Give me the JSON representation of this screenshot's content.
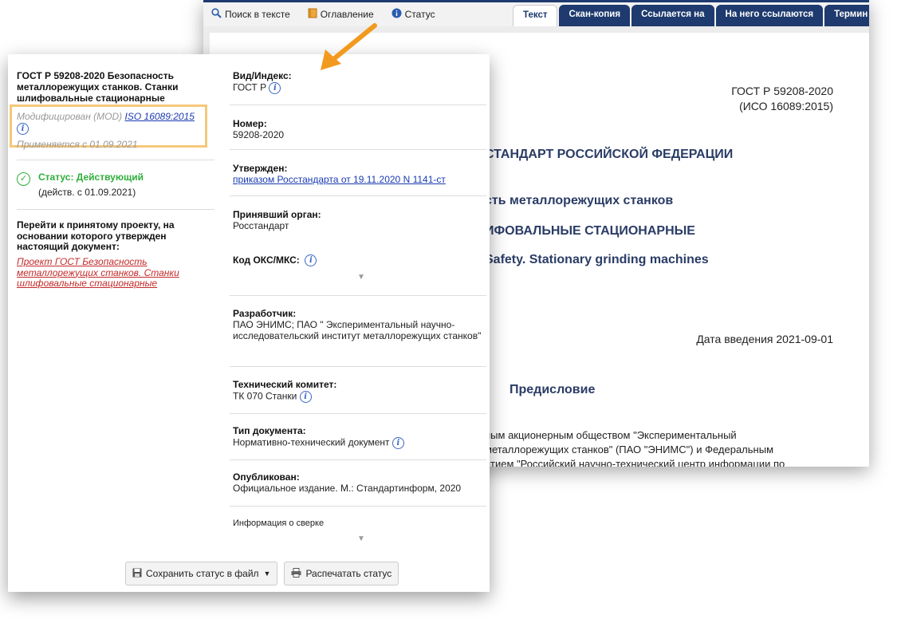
{
  "toolbar": {
    "search": "Поиск в тексте",
    "toc": "Оглавление",
    "status": "Статус"
  },
  "tabs": [
    "Текст",
    "Скан-копия",
    "Ссылается на",
    "На него ссылаются",
    "Термин"
  ],
  "doc": {
    "code": "ГОСТ Р 59208-2020",
    "iso": "(ИСО 16089:2015)",
    "h1": "СТАНДАРТ РОССИЙСКОЙ ФЕДЕРАЦИИ",
    "h2": "сть металлорежущих станков",
    "h3": "ИФОВАЛЬНЫЕ СТАЦИОНАРНЫЕ",
    "h4": "Safety. Stationary grinding machines",
    "date": "Дата введения 2021-09-01",
    "preface": "Предисловие",
    "p1": "ным     акционерным     обществом     \"Экспериментальный",
    "p2": "металлорежущих станков\" (ПАО \"ЭНИМС\") и Федеральным",
    "p3": "ятием \"Российский научно-технический центр информации по"
  },
  "left": {
    "title": "ГОСТ Р 59208-2020 Безопасность металлорежущих станков. Станки шлифовальные стационарные",
    "modified": "Модифицирован (MOD)",
    "iso_link": "ISO 16089:2015",
    "applies": "Применяется с 01.09.2021",
    "status_label": "Статус: Действующий",
    "status_date": "(действ. с 01.09.2021)",
    "goto": "Перейти к принятому проекту, на основании которого утвержден настоящий документ:",
    "goto_link": "Проект ГОСТ Безопасность металлорежущих станков. Станки шлифовальные стационарные"
  },
  "fields": {
    "kind_label": "Вид/Индекс:",
    "kind_value": "ГОСТ Р",
    "number_label": "Номер:",
    "number_value": "59208-2020",
    "approved_label": "Утвержден:",
    "approved_value": "приказом Росстандарта от 19.11.2020 N 1141-ст",
    "org_label": "Принявший орган:",
    "org_value": "Росстандарт",
    "oks_label": "Код ОКС/МКС:",
    "dev_label": "Разработчик:",
    "dev_value": "ПАО ЭНИМС; ПАО \" Экспериментальный научно-исследовательский институт металлорежущих станков\"",
    "tc_label": "Технический комитет:",
    "tc_value": "ТК 070 Станки",
    "type_label": "Тип документа:",
    "type_value": "Нормативно-технический документ",
    "pub_label": "Опубликован:",
    "pub_value": "Официальное издание. М.: Стандартинформ, 2020",
    "recon_label": "Информация о сверке"
  },
  "buttons": {
    "save": "Сохранить статус в файл",
    "print": "Распечатать статус"
  },
  "colors": {
    "nav": "#1e3a6e",
    "link": "#1a3bb3",
    "status": "#2fae3a",
    "highlight": "#f5c87a",
    "arrow": "#f29a1f"
  }
}
